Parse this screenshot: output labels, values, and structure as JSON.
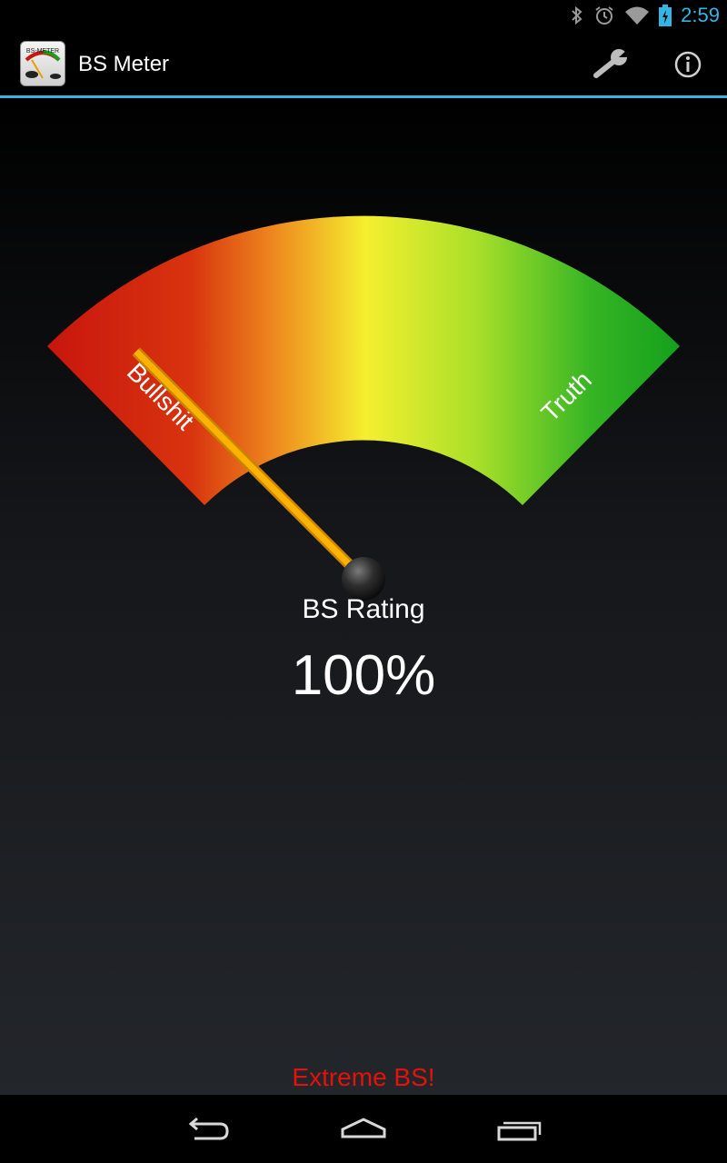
{
  "status_bar": {
    "time": "2:59",
    "icons": [
      "bluetooth-icon",
      "alarm-icon",
      "wifi-icon",
      "battery-charging-icon"
    ],
    "accent_color": "#33b5e5"
  },
  "action_bar": {
    "title": "BS Meter",
    "app_icon_text": "BS-METER",
    "actions": [
      "wrench-icon",
      "info-icon"
    ]
  },
  "gauge": {
    "left_label": "Bullshit",
    "right_label": "Truth",
    "needle_value_percent": 100,
    "colors": [
      "#c9170e",
      "#f5ef2e",
      "#15a11c"
    ]
  },
  "rating": {
    "label": "BS Rating",
    "value": "100%"
  },
  "verdict": {
    "text": "Extreme BS!",
    "color": "#e3120b"
  },
  "nav_bar": {
    "buttons": [
      "back-icon",
      "home-icon",
      "recent-apps-icon"
    ]
  }
}
